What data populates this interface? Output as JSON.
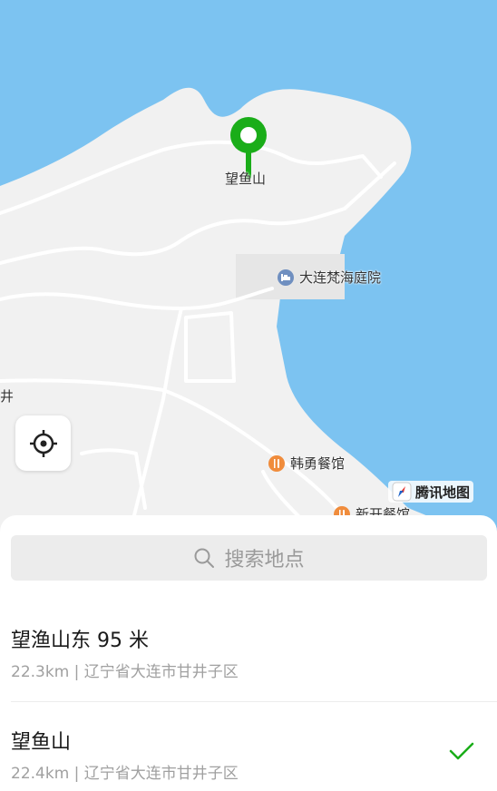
{
  "map": {
    "pin_label": "望鱼山",
    "poi_hotel": "大连梵海庭院",
    "poi_restaurant_1": "韩勇餐馆",
    "poi_restaurant_2": "新开餐馆",
    "edge_label": "井",
    "brand": "腾讯地图"
  },
  "search": {
    "placeholder": "搜索地点"
  },
  "results": [
    {
      "title": "望渔山东 95 米",
      "subtitle": "22.3km | 辽宁省大连市甘井子区",
      "selected": false
    },
    {
      "title": "望鱼山",
      "subtitle": "22.4km | 辽宁省大连市甘井子区",
      "selected": true
    }
  ],
  "colors": {
    "water": "#7cc3f1",
    "land": "#f1f1f1",
    "pin": "#1aad19",
    "check": "#1aad19"
  }
}
